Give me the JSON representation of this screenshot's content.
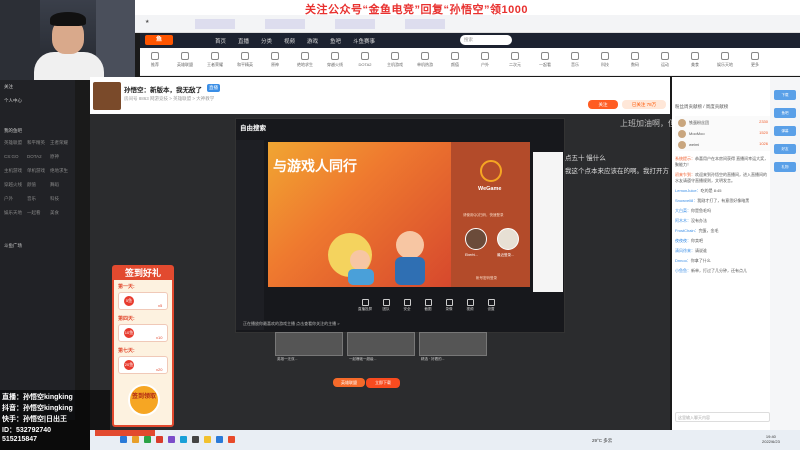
{
  "banner": {
    "text": "关注公众号“金鱼电竞”回复“孙悟空”领1000"
  },
  "site": {
    "nav": [
      "首页",
      "直播",
      "分类",
      "视频",
      "游戏",
      "鱼吧",
      "斗鱼赛事"
    ],
    "search_placeholder": "搜索",
    "categories": [
      "推荐",
      "英雄联盟",
      "王者荣耀",
      "和平精英",
      "原神",
      "绝地求生",
      "穿越火线",
      "DOTA2",
      "主机游戏",
      "单机热游",
      "颜值",
      "户外",
      "二次元",
      "一起看",
      "音乐",
      "科技",
      "数码",
      "运动",
      "美食",
      "娱乐天地",
      "更多"
    ]
  },
  "room": {
    "title": "孙悟空：新版本，我无敌了",
    "tag": "直播",
    "meta": "房间号 8863  网游竞技 > 英雄联盟 > 大神教学",
    "follow_label": "关注",
    "fans_label": "已关注 78万"
  },
  "video": {
    "top_text": "上班加油啊，但",
    "line1": "点五十 慢什么",
    "line2": "我这个点本来应该在的啊。我打开方"
  },
  "wegame": {
    "title": "自由搜索",
    "banner_title": "与游戏人同行",
    "logo_text": "WeGame",
    "login_hint": "请使用QQ扫码，快速登录",
    "accounts": [
      "Eberhi...",
      "最近登录..."
    ],
    "register": "帐号密码登录",
    "toolbar": [
      "直播投屏",
      "团队",
      "安全",
      "截图",
      "录像",
      "视频",
      "设置"
    ],
    "bottom_text": "正在播放你最喜欢的游戏主播  点击查看你关注的主播 >"
  },
  "thumbs": [
    {
      "caption": "英雄一无双..."
    },
    {
      "caption": "一起爆破一超级..."
    },
    {
      "caption": "精选 · 好看的..."
    }
  ],
  "play": {
    "btn1": "英雄联盟",
    "btn2": "立即下载"
  },
  "sign": {
    "title": "签到好礼",
    "days": [
      "第一天:",
      "第四天:",
      "第七天:"
    ],
    "rewards": [
      "x5",
      "x10",
      "x20"
    ],
    "coins": [
      "5鱼",
      "10鱼",
      "20鱼"
    ],
    "button": "签到领取"
  },
  "chat": {
    "tabs": "粉丝周贡献榜 / 周度贡献榜",
    "rank": [
      {
        "name": "铁蛋粉丝团",
        "value": "2330"
      },
      {
        "name": "MooMoo",
        "value": "1520"
      },
      {
        "name": "weimi",
        "value": "1026"
      }
    ],
    "messages": [
      {
        "name": "系统提示：",
        "text": "恭喜用户在本房间获得 直播间幸运大奖，聚能力！"
      },
      {
        "name": "初来乍到：",
        "text": "欢迎来到孙悟空的直播间，进入直播间的水友请遵守直播规则，文明发言。"
      },
      {
        "name": "LemonJuice：",
        "text": "吃的是 8:45"
      },
      {
        "name": "Snowvell8：",
        "text": "我刚才打了，有意思好像暗黑"
      },
      {
        "name": "大白菜：",
        "text": "你是鱼毛吗"
      },
      {
        "name": "阿木木：",
        "text": "没有办法"
      },
      {
        "name": "FrostChain：",
        "text": "完蛋，金毛"
      },
      {
        "name": "夜夜夜：",
        "text": "你卖吧"
      },
      {
        "name": "清风徐来：",
        "text": "请说谁"
      },
      {
        "name": "Dnnoo：",
        "text": "你拿了什么"
      },
      {
        "name": "小鱼鱼：",
        "text": "新单，打过了几分钟，还有点儿"
      }
    ],
    "input_placeholder": "这里输入聊天内容"
  },
  "right_rail": [
    "下载",
    "鱼吧",
    "弹幕",
    "好友",
    "礼物"
  ],
  "overlay": {
    "lines": [
      "直播：孙悟空kingking",
      "抖音：孙悟空kingking",
      "快手：孙悟空|日出王",
      "ID：532792740",
      "515215847"
    ]
  },
  "taskbar": {
    "weather": "29°C 多云",
    "time": "19:40",
    "date": "2022/6/23"
  },
  "sidebar": {
    "sections": [
      "关注",
      "个人中心",
      "我的鱼吧",
      "斗鱼广场"
    ],
    "items": [
      "英雄联盟",
      "和平精英",
      "王者荣耀",
      "CS:GO",
      "DOTA2",
      "原神",
      "主机游戏",
      "单机游戏",
      "绝地求生",
      "穿越火线",
      "颜值",
      "舞蹈",
      "户外",
      "音乐",
      "科技",
      "娱乐天地",
      "一起看",
      "美食"
    ]
  }
}
